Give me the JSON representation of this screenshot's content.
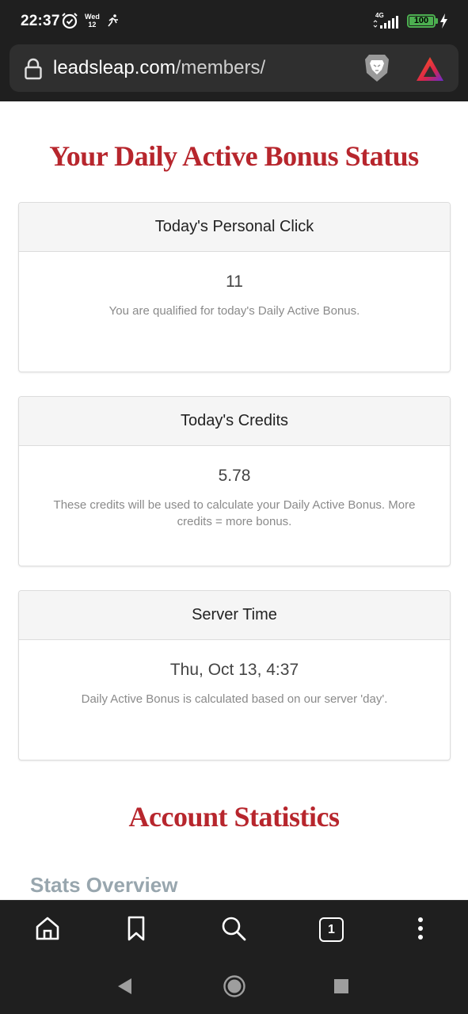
{
  "status_bar": {
    "time": "22:37",
    "date_day": "Wed",
    "date_num": "12",
    "network": "4G",
    "battery": "100"
  },
  "browser": {
    "url_host": "leadsleap.com",
    "url_path": "/members/",
    "tab_count": "1"
  },
  "page": {
    "daily_bonus_title": "Your Daily Active Bonus Status",
    "cards": [
      {
        "header": "Today's Personal Click",
        "value": "11",
        "note": "You are qualified for today's Daily Active Bonus."
      },
      {
        "header": "Today's Credits",
        "value": "5.78",
        "note": "These credits will be used to calculate your Daily Active Bonus. More credits = more bonus."
      },
      {
        "header": "Server Time",
        "value": "Thu, Oct 13, 4:37",
        "note": "Daily Active Bonus is calculated based on our server 'day'."
      }
    ],
    "account_stats_title": "Account Statistics",
    "stats_overview_label": "Stats Overview"
  },
  "colors": {
    "title_red": "#b7262d",
    "stats_gray": "#98a6ae",
    "battery_green": "#4caf50"
  }
}
